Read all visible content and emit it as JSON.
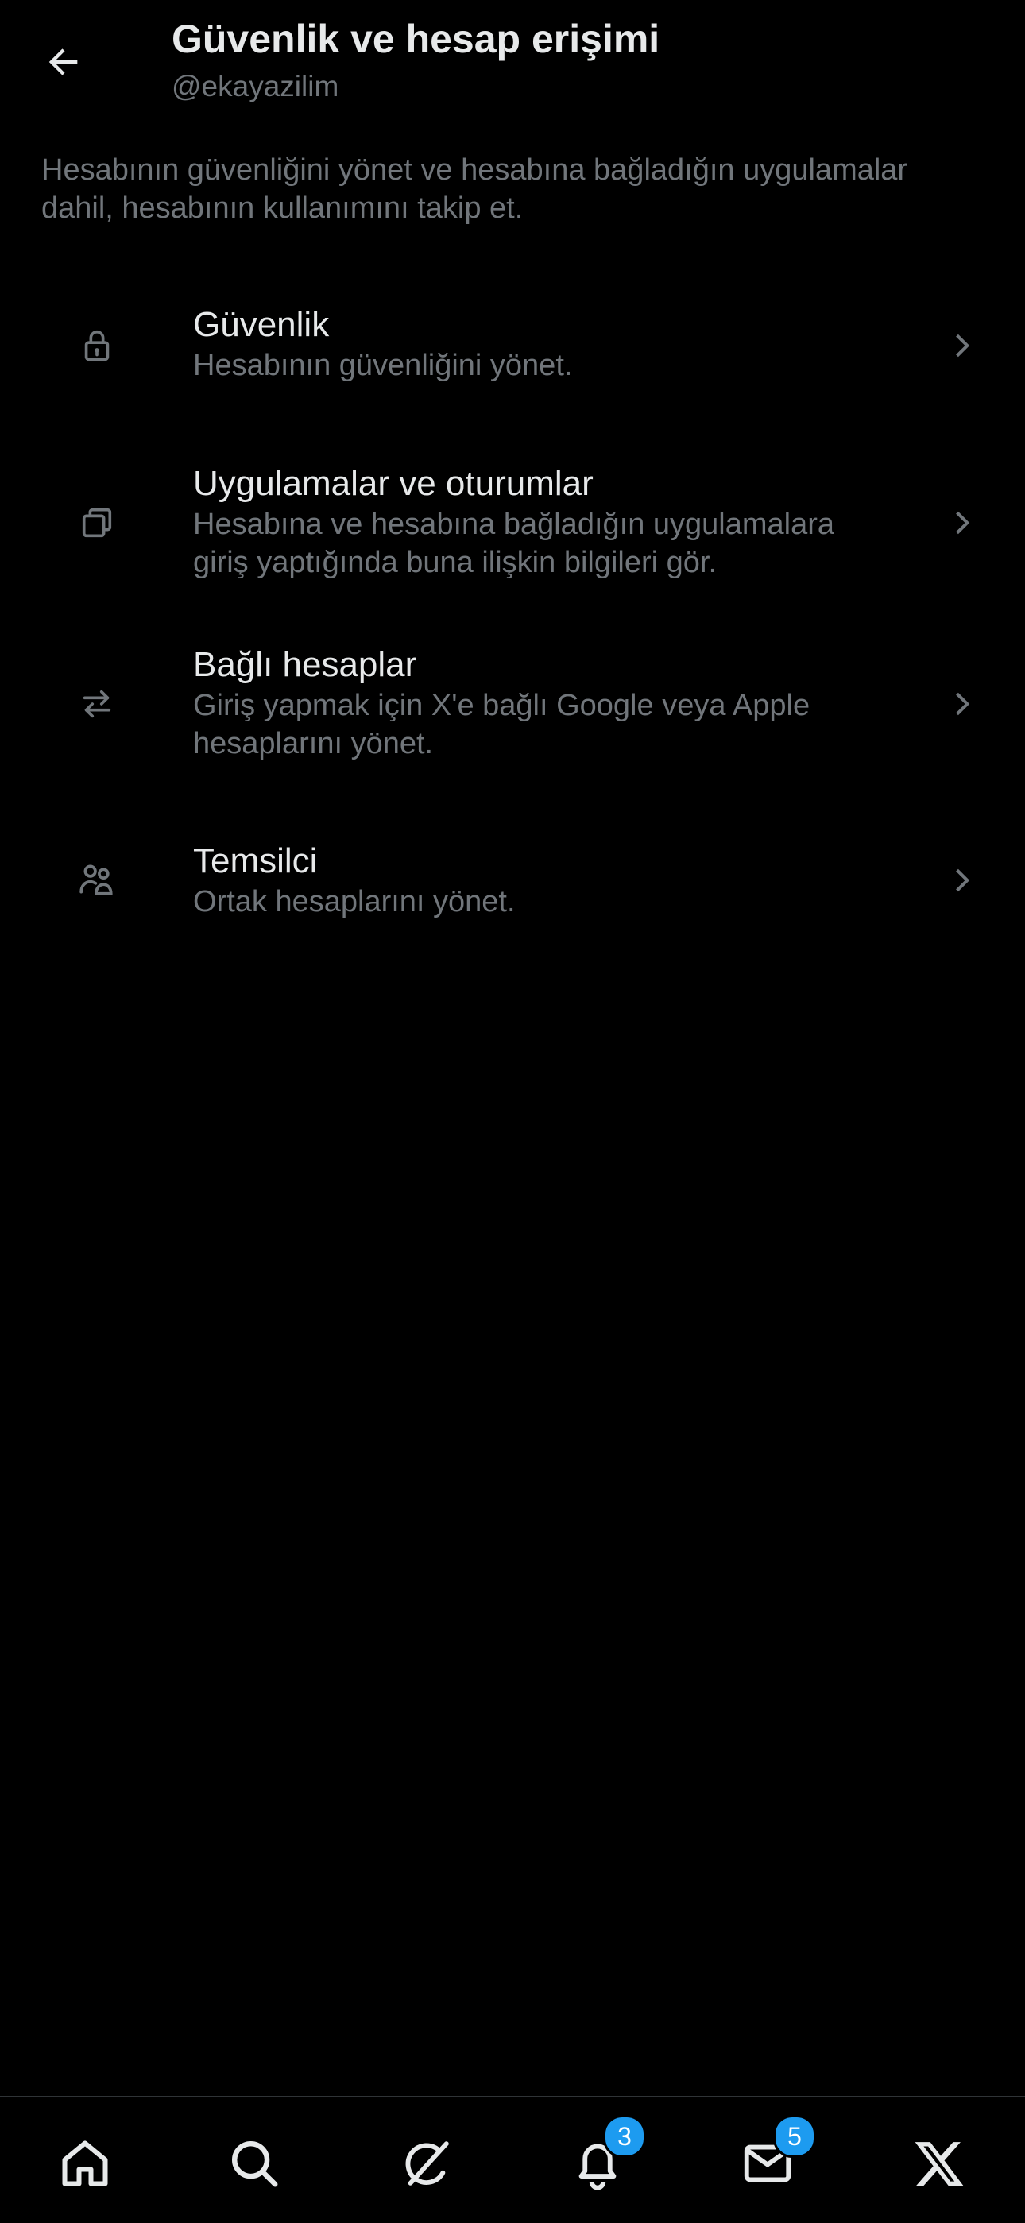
{
  "header": {
    "title": "Güvenlik ve hesap erişimi",
    "username": "@ekayazilim"
  },
  "description": "Hesabının güvenliğini yönet ve hesabına bağladığın uygulamalar dahil, hesabının kullanımını takip et.",
  "menu": [
    {
      "icon": "lock-icon",
      "title": "Güvenlik",
      "description": "Hesabının güvenliğini yönet."
    },
    {
      "icon": "copy-icon",
      "title": "Uygulamalar ve oturumlar",
      "description": "Hesabına ve hesabına bağladığın uygulamalara giriş yaptığında buna ilişkin bilgileri gör."
    },
    {
      "icon": "swap-arrows-icon",
      "title": "Bağlı hesaplar",
      "description": "Giriş yapmak için X'e bağlı Google veya Apple hesaplarını yönet."
    },
    {
      "icon": "people-icon",
      "title": "Temsilci",
      "description": "Ortak hesaplarını yönet."
    }
  ],
  "bottom_nav": {
    "items": [
      {
        "icon": "home-icon"
      },
      {
        "icon": "search-icon"
      },
      {
        "icon": "grok-icon"
      },
      {
        "icon": "bell-icon",
        "badge": "3"
      },
      {
        "icon": "mail-icon",
        "badge": "5"
      },
      {
        "icon": "x-logo-icon"
      }
    ]
  },
  "colors": {
    "background": "#000000",
    "primary_text": "#e7e9ea",
    "secondary_text": "#71767b",
    "accent": "#1d9bf0",
    "divider": "#2f3336"
  }
}
